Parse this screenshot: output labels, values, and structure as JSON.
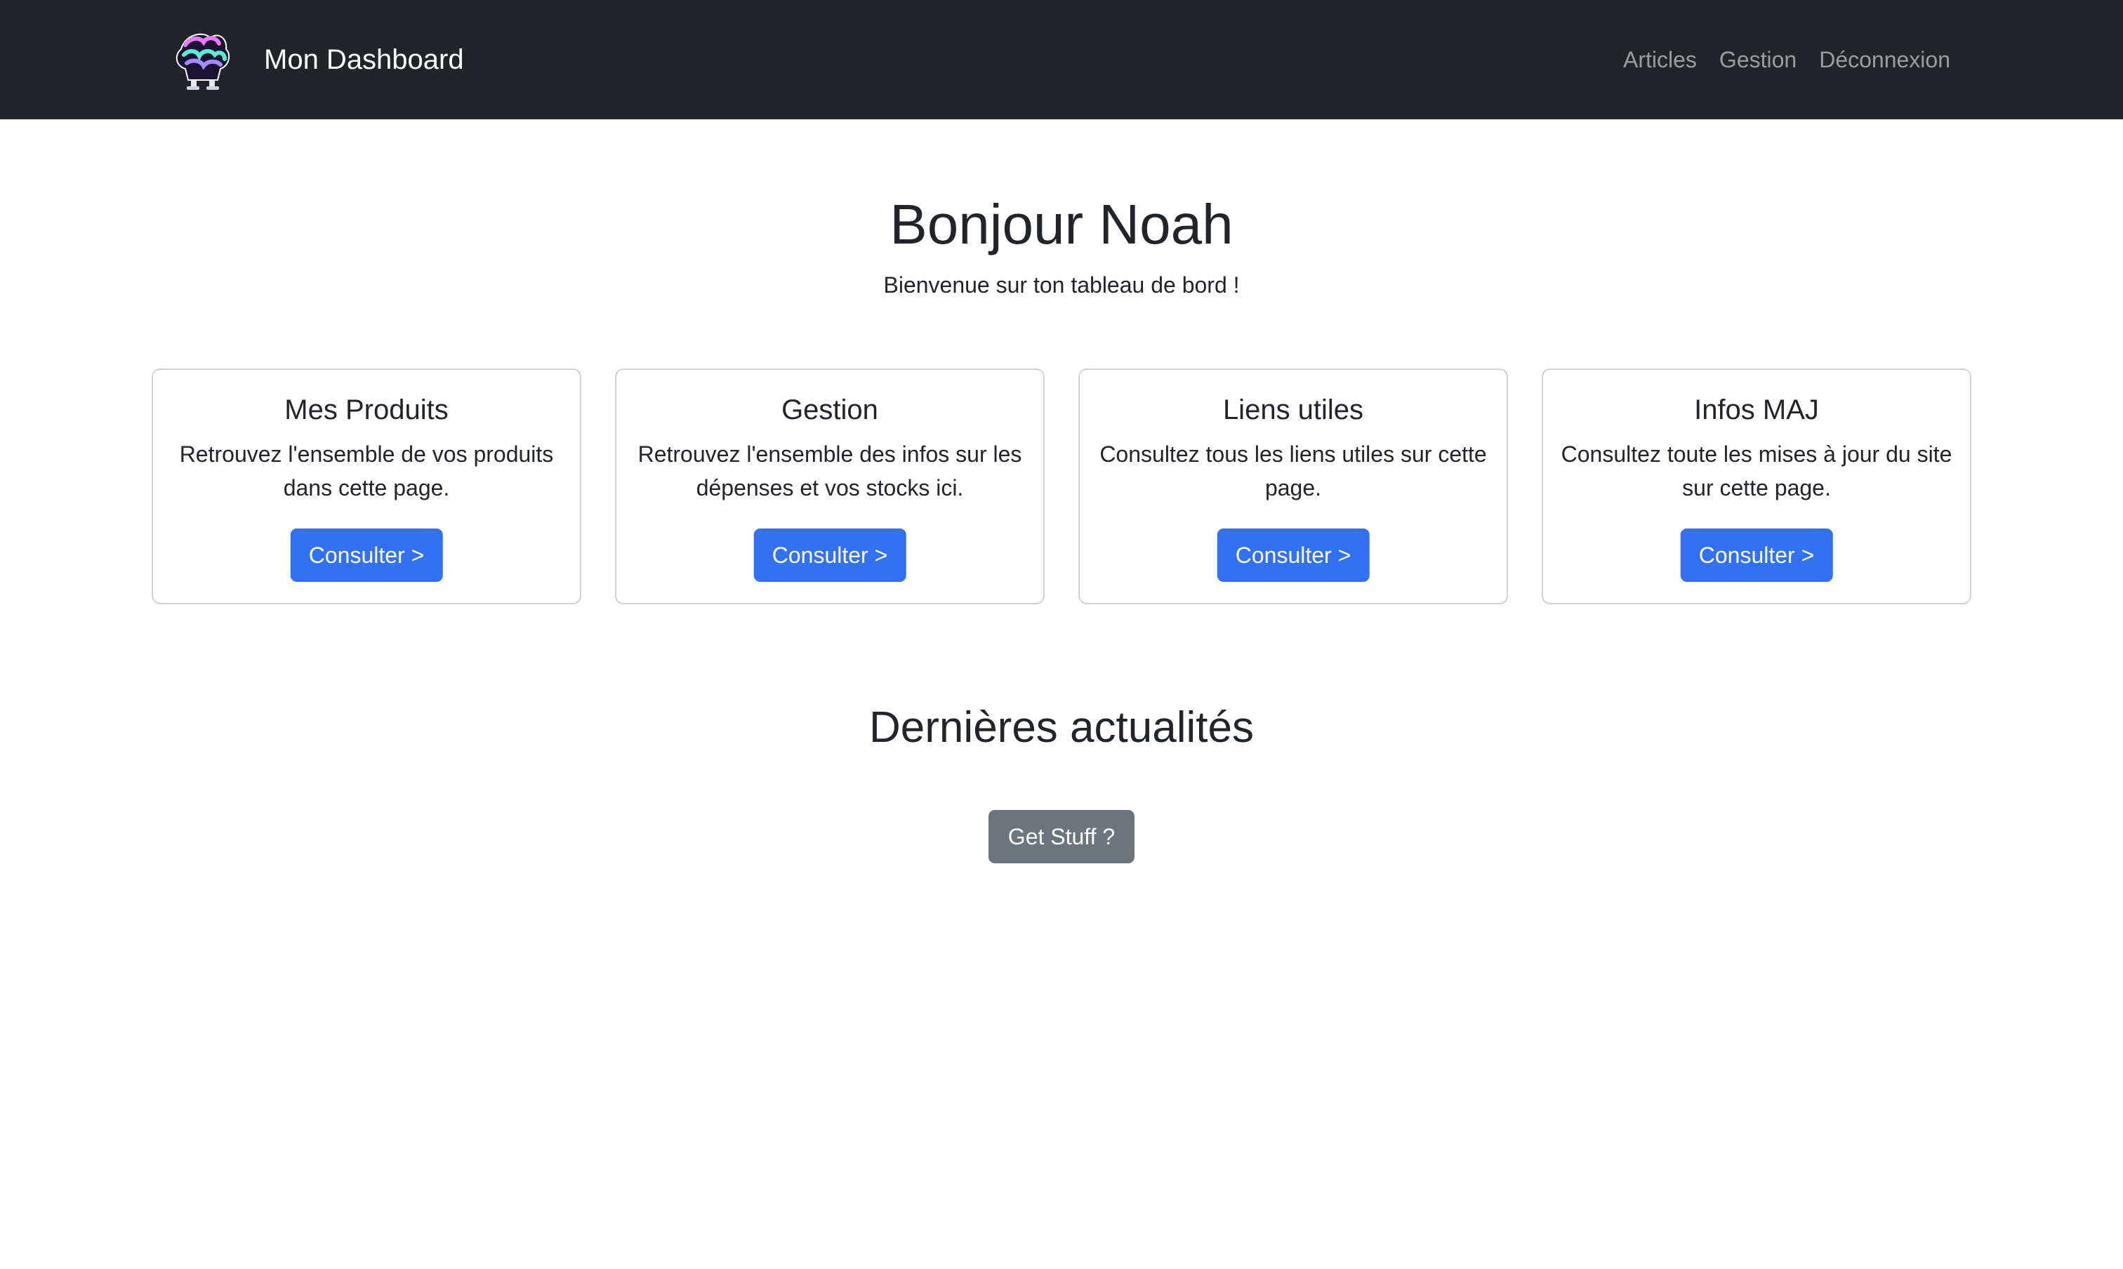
{
  "navbar": {
    "brand_name": "Mon Dashboard",
    "logo_icon": "stuff-mascot-logo",
    "links": [
      {
        "label": "Articles"
      },
      {
        "label": "Gestion"
      },
      {
        "label": "Déconnexion"
      }
    ],
    "background_color": "#212529"
  },
  "hero": {
    "title": "Bonjour Noah",
    "subtitle": "Bienvenue sur ton tableau de bord !"
  },
  "cards": [
    {
      "title": "Mes Produits",
      "text": "Retrouvez l'ensemble de vos produits dans cette page.",
      "button_label": "Consulter >"
    },
    {
      "title": "Gestion",
      "text": "Retrouvez l'ensemble des infos sur les dépenses et vos stocks ici.",
      "button_label": "Consulter >"
    },
    {
      "title": "Liens utiles",
      "text": "Consultez tous les liens utiles sur cette page.",
      "button_label": "Consulter >"
    },
    {
      "title": "Infos MAJ",
      "text": "Consultez toute les mises à jour du site sur cette page.",
      "button_label": "Consulter >"
    }
  ],
  "news": {
    "title": "Dernières actualités",
    "button_label": "Get Stuff ?"
  },
  "colors": {
    "primary": "#3271f1",
    "secondary": "#6c757d",
    "text": "#212529"
  }
}
